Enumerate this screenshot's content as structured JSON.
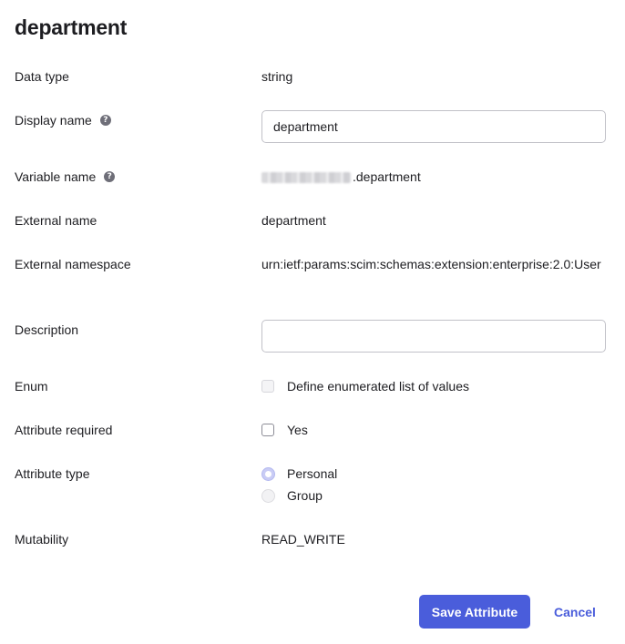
{
  "title": "department",
  "fields": {
    "data_type": {
      "label": "Data type",
      "value": "string"
    },
    "display_name": {
      "label": "Display name",
      "value": "department"
    },
    "variable_name": {
      "label": "Variable name",
      "value": ".department"
    },
    "external_name": {
      "label": "External name",
      "value": "department"
    },
    "external_namespace": {
      "label": "External namespace",
      "value": "urn:ietf:params:scim:schemas:extension:enterprise:2.0:User"
    },
    "description": {
      "label": "Description",
      "value": ""
    },
    "enum": {
      "label": "Enum",
      "option_label": "Define enumerated list of values",
      "checked": false,
      "disabled": true
    },
    "attribute_required": {
      "label": "Attribute required",
      "option_label": "Yes",
      "checked": false
    },
    "attribute_type": {
      "label": "Attribute type",
      "options": [
        "Personal",
        "Group"
      ],
      "selected": "Personal"
    },
    "mutability": {
      "label": "Mutability",
      "value": "READ_WRITE"
    }
  },
  "help_glyph": "?",
  "icons": {
    "help": "question-circle-icon"
  },
  "colors": {
    "primary": "#4a5ddb",
    "radio_selected": "#c9ccf5"
  },
  "actions": {
    "save_label": "Save Attribute",
    "cancel_label": "Cancel"
  }
}
